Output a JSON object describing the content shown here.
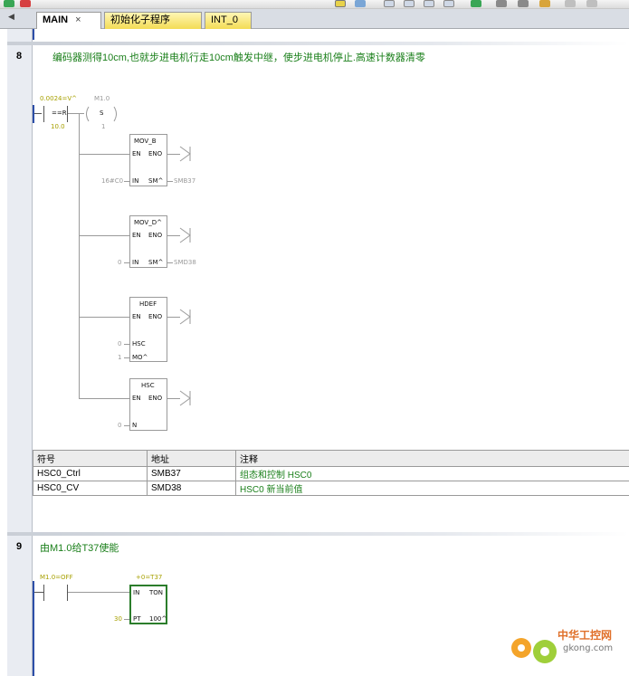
{
  "tabs": [
    {
      "label": "MAIN",
      "close": "×"
    },
    {
      "label": "初始化子程序"
    },
    {
      "label": "INT_0"
    }
  ],
  "networks": [
    {
      "number": "8",
      "title": "编码器测得10cm,也就步进电机行走10cm触发中继，使步进电机停止.高速计数器清零",
      "compare": {
        "top": "0.0024=V^",
        "op": "==R",
        "bottom": "10.0"
      },
      "coil": {
        "top": "M1.0",
        "op": "S",
        "bottom": "1"
      },
      "boxes": [
        {
          "title": "MOV_B",
          "en": "EN",
          "eno": "ENO",
          "pins": [
            {
              "in_value": "16#C0",
              "in": "IN",
              "out": "SM^",
              "out_value": "SMB37"
            }
          ]
        },
        {
          "title": "MOV_D^",
          "en": "EN",
          "eno": "ENO",
          "pins": [
            {
              "in_value": "0",
              "in": "IN",
              "out": "SM^",
              "out_value": "SMD38"
            }
          ]
        },
        {
          "title": "HDEF",
          "en": "EN",
          "eno": "ENO",
          "pins": [
            {
              "in_value": "0",
              "in": "HSC"
            },
            {
              "in_value": "1",
              "in": "MO^"
            }
          ]
        },
        {
          "title": "HSC",
          "en": "EN",
          "eno": "ENO",
          "pins": [
            {
              "in_value": "0",
              "in": "N"
            }
          ]
        }
      ],
      "symbol_table": {
        "headers": [
          "符号",
          "地址",
          "注释"
        ],
        "rows": [
          [
            "HSC0_Ctrl",
            "SMB37",
            "组态和控制 HSC0"
          ],
          [
            "HSC0_CV",
            "SMD38",
            "HSC0 新当前值"
          ]
        ]
      }
    },
    {
      "number": "9",
      "title": "由M1.0给T37使能",
      "contact": {
        "label": "M1.0=OFF"
      },
      "timer": {
        "top": "+0=T37",
        "in": "IN",
        "type": "TON",
        "pt": "PT",
        "base": "100^",
        "pt_value": "30"
      }
    }
  ],
  "watermark": {
    "text": "中华工控网",
    "url": "gkong.com"
  },
  "colors": {
    "rail": "#2c4ea8",
    "comment": "#1a7f1a",
    "value": "#a7a000",
    "active_box": "#2b7d2b"
  }
}
